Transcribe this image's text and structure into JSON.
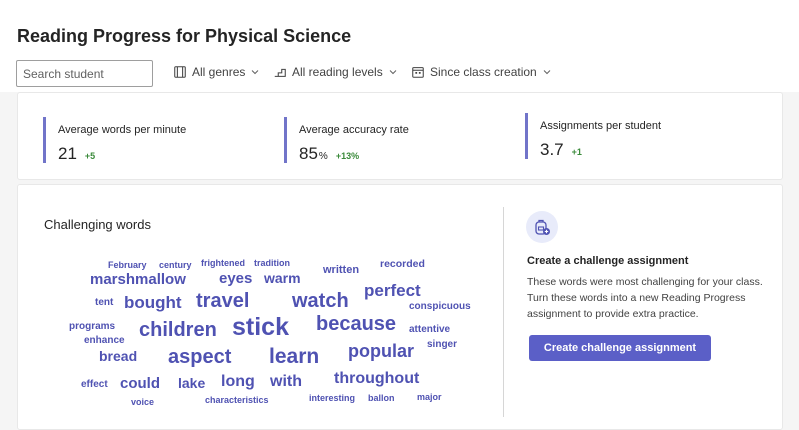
{
  "header": {
    "title": "Reading Progress for Physical Science",
    "search_placeholder": "Search student",
    "filters": [
      {
        "label": "All genres",
        "icon": "book-icon"
      },
      {
        "label": "All reading levels",
        "icon": "steps-icon"
      },
      {
        "label": "Since class creation",
        "icon": "calendar-icon"
      }
    ]
  },
  "stats": [
    {
      "label": "Average words per minute",
      "value": "21",
      "unit": "",
      "delta": "+5"
    },
    {
      "label": "Average accuracy rate",
      "value": "85",
      "unit": "%",
      "delta": "+13%"
    },
    {
      "label": "Assignments per student",
      "value": "3.7",
      "unit": "",
      "delta": "+1"
    }
  ],
  "challenging_words": {
    "title": "Challenging words",
    "words": [
      "February",
      "century",
      "frightened",
      "tradition",
      "written",
      "recorded",
      "marshmallow",
      "eyes",
      "warm",
      "perfect",
      "tent",
      "bought",
      "travel",
      "watch",
      "conspicuous",
      "programs",
      "children",
      "stick",
      "because",
      "attentive",
      "enhance",
      "singer",
      "bread",
      "aspect",
      "learn",
      "popular",
      "effect",
      "could",
      "lake",
      "long",
      "with",
      "throughout",
      "voice",
      "characteristics",
      "interesting",
      "ballon",
      "major"
    ]
  },
  "challenge": {
    "title": "Create a challenge assignment",
    "description": "These words were most challenging for your class. Turn these words into a new Reading Progress assignment to provide extra practice.",
    "button_label": "Create challenge assignment",
    "icon": "backpack-add-icon"
  },
  "colors": {
    "accent": "#5b5fc7",
    "word": "#4f52b2",
    "positive": "#3a8a3a"
  }
}
